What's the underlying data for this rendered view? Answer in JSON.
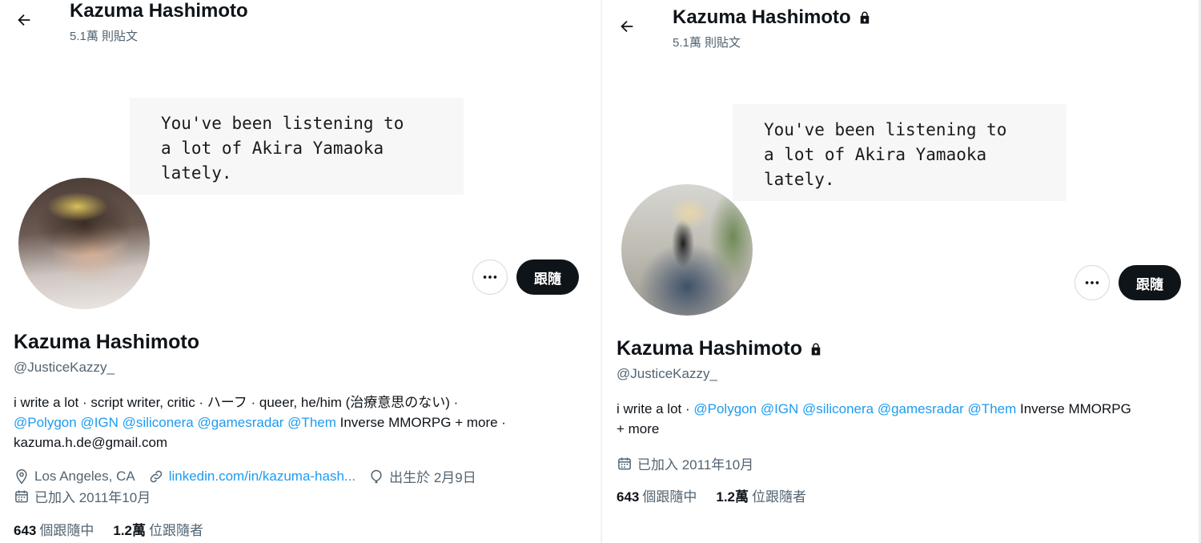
{
  "left": {
    "header_title": "Kazuma Hashimoto",
    "header_posts": "5.1萬 則貼文",
    "banner_lines": "You've been listening to\na lot of Akira Yamaoka\nlately.",
    "follow_label": "跟隨",
    "name": "Kazuma Hashimoto",
    "handle": "@JusticeKazzy_",
    "bio_line1": "i write a lot · script writer, critic · ハーフ · queer, he/him (治療意思のない) ·",
    "mentions": [
      "@Polygon",
      "@IGN",
      "@siliconera",
      "@gamesradar",
      "@Them"
    ],
    "bio_tail": "Inverse MMORPG + more ·",
    "bio_email": "kazuma.h.de@gmail.com",
    "location": "Los Angeles, CA",
    "website": "linkedin.com/in/kazuma-hash...",
    "birthday": "出生於 2月9日",
    "joined": "已加入 2011年10月",
    "following_count": "643",
    "following_label": "個跟隨中",
    "followers_count": "1.2萬",
    "followers_label": "位跟隨者"
  },
  "right": {
    "header_title": "Kazuma Hashimoto",
    "header_posts": "5.1萬 則貼文",
    "banner_lines": "You've been listening to\na lot of Akira Yamaoka\nlately.",
    "follow_label": "跟隨",
    "name": "Kazuma Hashimoto",
    "handle": "@JusticeKazzy_",
    "bio_start": "i write a lot ·",
    "mentions": [
      "@Polygon",
      "@IGN",
      "@siliconera",
      "@gamesradar",
      "@Them"
    ],
    "bio_tail": "Inverse MMORPG",
    "bio_more": "+ more",
    "joined": "已加入 2011年10月",
    "following_count": "643",
    "following_label": "個跟隨中",
    "followers_count": "1.2萬",
    "followers_label": "位跟隨者"
  },
  "colors": {
    "accent": "#1d9bf0",
    "text": "#0f1419",
    "secondary": "#536471"
  },
  "icons": [
    "back-arrow-icon",
    "lock-icon",
    "more-dots-icon",
    "location-icon",
    "link-icon",
    "balloon-icon",
    "calendar-icon"
  ]
}
